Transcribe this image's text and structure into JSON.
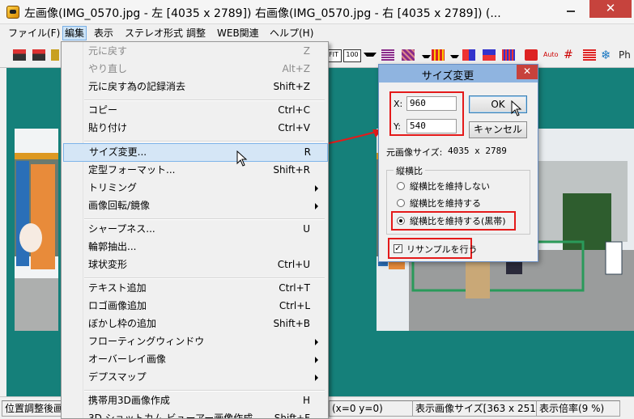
{
  "title_bar": {
    "title": "左画像(IMG_0570.jpg - 左 [4035 x 2789]) 右画像(IMG_0570.jpg - 右 [4035 x 2789]) (...",
    "minimize_icon": "minimize-icon",
    "close_glyph": "✕"
  },
  "menubar": {
    "items": [
      "ファイル(F)",
      "編集",
      "表示",
      "ステレオ形式",
      "調整",
      "WEB関連",
      "ヘルプ(H)"
    ]
  },
  "toolbar": {
    "fit_label": "FIT",
    "zoom_label": "100",
    "auto_label": "Auto"
  },
  "edit_menu": {
    "items": [
      {
        "label": "元に戻す",
        "shortcut": "Z"
      },
      {
        "label": "やり直し",
        "shortcut": "Alt+Z"
      },
      {
        "label": "元に戻す為の記録消去",
        "shortcut": "Shift+Z"
      },
      {
        "label": "コピー",
        "shortcut": "Ctrl+C"
      },
      {
        "label": "貼り付け",
        "shortcut": "Ctrl+V"
      },
      {
        "label": "サイズ変更...",
        "shortcut": "R"
      },
      {
        "label": "定型フォーマット...",
        "shortcut": "Shift+R"
      },
      {
        "label": "トリミング",
        "shortcut": ""
      },
      {
        "label": "画像回転/鏡像",
        "shortcut": ""
      },
      {
        "label": "シャープネス...",
        "shortcut": "U"
      },
      {
        "label": "輪郭抽出...",
        "shortcut": ""
      },
      {
        "label": "球状変形",
        "shortcut": "Ctrl+U"
      },
      {
        "label": "テキスト追加",
        "shortcut": "Ctrl+T"
      },
      {
        "label": "ロゴ画像追加",
        "shortcut": "Ctrl+L"
      },
      {
        "label": "ぼかし枠の追加",
        "shortcut": "Shift+B"
      },
      {
        "label": "フローティングウィンドウ",
        "shortcut": ""
      },
      {
        "label": "オーバーレイ画像",
        "shortcut": ""
      },
      {
        "label": "デプスマップ",
        "shortcut": ""
      },
      {
        "label": "携帯用3D画像作成",
        "shortcut": "H"
      },
      {
        "label": "3D ショットカム ビューアー画像作成",
        "shortcut": "Shift+F"
      }
    ]
  },
  "resize_dialog": {
    "title": "サイズ変更",
    "x_label": "X:",
    "x_value": "960",
    "y_label": "Y:",
    "y_value": "540",
    "ok_label": "OK",
    "cancel_label": "キャンセル",
    "original_size_label": "元画像サイズ:",
    "original_size_value": "4035 x 2789",
    "aspect_group_label": "縦横比",
    "aspect_options": [
      "縦横比を維持しない",
      "縦横比を維持する",
      "縦横比を維持する(黒帯)"
    ],
    "aspect_selected_index": 2,
    "resample_label": "リサンプルを行う",
    "resample_checked": true
  },
  "status_bar": {
    "left_text": "位置調整後画",
    "offset_text": "(x=0 y=0)",
    "display_size": "表示画像サイズ[363 x 251]",
    "zoom_ratio": "表示倍率(9 %)"
  },
  "colors": {
    "background_teal": "#15807a",
    "annotation_red": "#e41a1a",
    "menu_highlight": "#d5e6f6"
  }
}
